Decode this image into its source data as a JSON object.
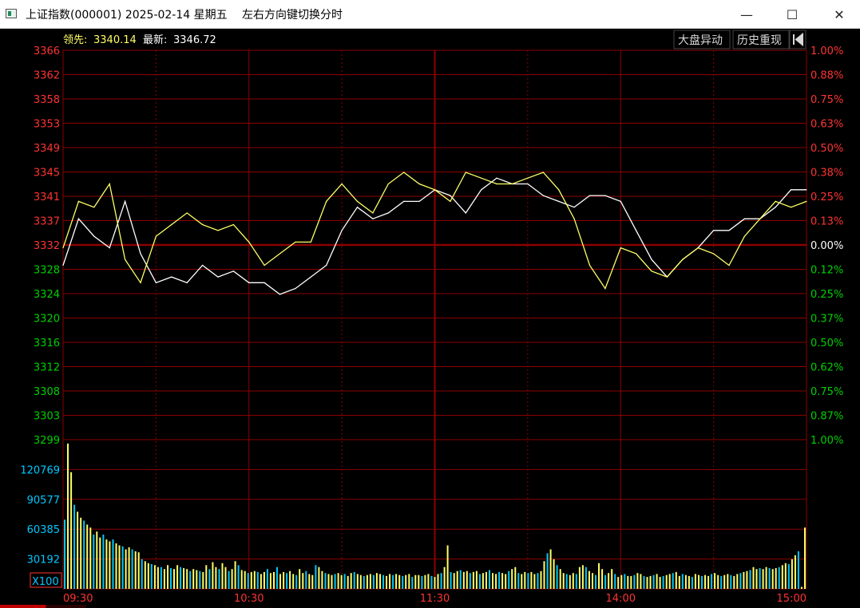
{
  "window": {
    "title": "上证指数(000001) 2025-02-14 星期五",
    "hint": "左右方向键切换分时",
    "minimize": "—",
    "maximize": "☐",
    "close": "✕"
  },
  "header": {
    "leader_label": "领先:",
    "leader_value": "3340.14",
    "latest_label": "最新:",
    "latest_value": "3346.72",
    "buttons": [
      "大盘异动",
      "历史重现"
    ],
    "back_icon": "back-to-start-icon"
  },
  "colors": {
    "background": "#000000",
    "grid": "#8b0000",
    "up": "#ff3333",
    "down": "#00d000",
    "flat": "#ffffff",
    "price_line": "#ffffff",
    "leader_line": "#ffff66",
    "volume_axis": "#00c8ff"
  },
  "chart_data": [
    {
      "type": "line",
      "title": "",
      "x_ticks": [
        "09:30",
        "10:30",
        "11:30",
        "14:00",
        "15:00"
      ],
      "y_left_ticks": [
        "3366",
        "3362",
        "3358",
        "3353",
        "3349",
        "3345",
        "3341",
        "3337",
        "3332",
        "3328",
        "3324",
        "3320",
        "3316",
        "3312",
        "3308",
        "3303",
        "3299"
      ],
      "y_right_ticks": [
        "1.00%",
        "0.88%",
        "0.75%",
        "0.63%",
        "0.50%",
        "0.38%",
        "0.25%",
        "0.13%",
        "0.00%",
        "0.12%",
        "0.25%",
        "0.37%",
        "0.50%",
        "0.62%",
        "0.75%",
        "0.87%",
        "1.00%"
      ],
      "prev_close": 3332.48,
      "ylim": [
        3299,
        3366
      ],
      "series": [
        {
          "name": "最新",
          "x": [
            0,
            5,
            10,
            15,
            20,
            25,
            30,
            35,
            40,
            45,
            50,
            55,
            60,
            65,
            70,
            75,
            80,
            85,
            90,
            95,
            100,
            105,
            110,
            115,
            120,
            125,
            130,
            135,
            140,
            145,
            150,
            155,
            160,
            165,
            170,
            175,
            180,
            185,
            190,
            195,
            200,
            205,
            210,
            215,
            220,
            225,
            230,
            235,
            240
          ],
          "values": [
            3329,
            3337,
            3334,
            3332,
            3340,
            3331,
            3326,
            3327,
            3326,
            3329,
            3327,
            3328,
            3326,
            3326,
            3324,
            3325,
            3327,
            3329,
            3335,
            3339,
            3337,
            3338,
            3340,
            3340,
            3342,
            3341,
            3338,
            3342,
            3344,
            3343,
            3343,
            3341,
            3340,
            3339,
            3341,
            3341,
            3340,
            3335,
            3330,
            3327,
            3330,
            3332,
            3335,
            3335,
            3337,
            3337,
            3339,
            3342,
            3342
          ]
        },
        {
          "name": "领先",
          "x": [
            0,
            5,
            10,
            15,
            20,
            25,
            30,
            35,
            40,
            45,
            50,
            55,
            60,
            65,
            70,
            75,
            80,
            85,
            90,
            95,
            100,
            105,
            110,
            115,
            120,
            125,
            130,
            135,
            140,
            145,
            150,
            155,
            160,
            165,
            170,
            175,
            180,
            185,
            190,
            195,
            200,
            205,
            210,
            215,
            220,
            225,
            230,
            235,
            240
          ],
          "values": [
            3332,
            3340,
            3339,
            3343,
            3330,
            3326,
            3334,
            3336,
            3338,
            3336,
            3335,
            3336,
            3333,
            3329,
            3331,
            3333,
            3333,
            3340,
            3343,
            3340,
            3338,
            3343,
            3345,
            3343,
            3342,
            3340,
            3345,
            3344,
            3343,
            3343,
            3344,
            3345,
            3342,
            3337,
            3329,
            3325,
            3332,
            3331,
            3328,
            3327,
            3330,
            3332,
            3331,
            3329,
            3334,
            3337,
            3340,
            3339,
            3340
          ]
        }
      ]
    },
    {
      "type": "bar",
      "title": "",
      "unit_label": "X100",
      "y_ticks": [
        "120769",
        "90577",
        "60385",
        "30192"
      ],
      "ylim": [
        0,
        150962
      ],
      "values": [
        70000,
        147000,
        118000,
        85000,
        78000,
        72000,
        69000,
        65000,
        62000,
        55000,
        58000,
        52000,
        55000,
        50000,
        48000,
        50000,
        46000,
        44000,
        43000,
        40000,
        42000,
        40000,
        38000,
        37000,
        30000,
        28000,
        26000,
        25000,
        24000,
        22000,
        22000,
        20000,
        24000,
        21000,
        20000,
        24000,
        22000,
        21000,
        20000,
        18000,
        20000,
        19000,
        18000,
        17000,
        24000,
        20000,
        27000,
        22000,
        20000,
        26000,
        22000,
        18000,
        20000,
        28000,
        24000,
        19000,
        18000,
        16000,
        17000,
        18000,
        17000,
        15000,
        17000,
        20000,
        16000,
        17000,
        22000,
        15000,
        17000,
        16000,
        18000,
        15000,
        14000,
        20000,
        16000,
        18000,
        15000,
        14000,
        24000,
        22000,
        18000,
        16000,
        15000,
        14000,
        15000,
        16000,
        14000,
        15000,
        13000,
        16000,
        17000,
        15000,
        14000,
        13000,
        14000,
        15000,
        14000,
        16000,
        15000,
        14000,
        13000,
        15000,
        14000,
        15000,
        14000,
        13000,
        14000,
        15000,
        12000,
        14000,
        14000,
        13000,
        14000,
        15000,
        13000,
        12000,
        15000,
        16000,
        22000,
        44000,
        17000,
        16000,
        18000,
        19000,
        17000,
        18000,
        16000,
        17000,
        18000,
        15000,
        16000,
        17000,
        19000,
        16000,
        15000,
        17000,
        16000,
        15000,
        18000,
        20000,
        22000,
        16000,
        15000,
        17000,
        16000,
        17000,
        15000,
        16000,
        18000,
        28000,
        36000,
        40000,
        30000,
        24000,
        20000,
        16000,
        15000,
        14000,
        16000,
        15000,
        22000,
        24000,
        22000,
        18000,
        16000,
        14000,
        26000,
        20000,
        14000,
        16000,
        20000,
        15000,
        12000,
        14000,
        15000,
        13000,
        13000,
        14000,
        16000,
        15000,
        13000,
        12000,
        13000,
        14000,
        15000,
        12000,
        13000,
        14000,
        15000,
        16000,
        17000,
        13000,
        15000,
        14000,
        13000,
        12000,
        15000,
        14000,
        13000,
        14000,
        13000,
        15000,
        16000,
        14000,
        13000,
        14000,
        15000,
        14000,
        13000,
        15000,
        16000,
        17000,
        18000,
        19000,
        22000,
        20000,
        21000,
        20000,
        22000,
        21000,
        20000,
        21000,
        22000,
        24000,
        26000,
        25000,
        30000,
        34000,
        38000,
        2000,
        62000
      ]
    }
  ]
}
